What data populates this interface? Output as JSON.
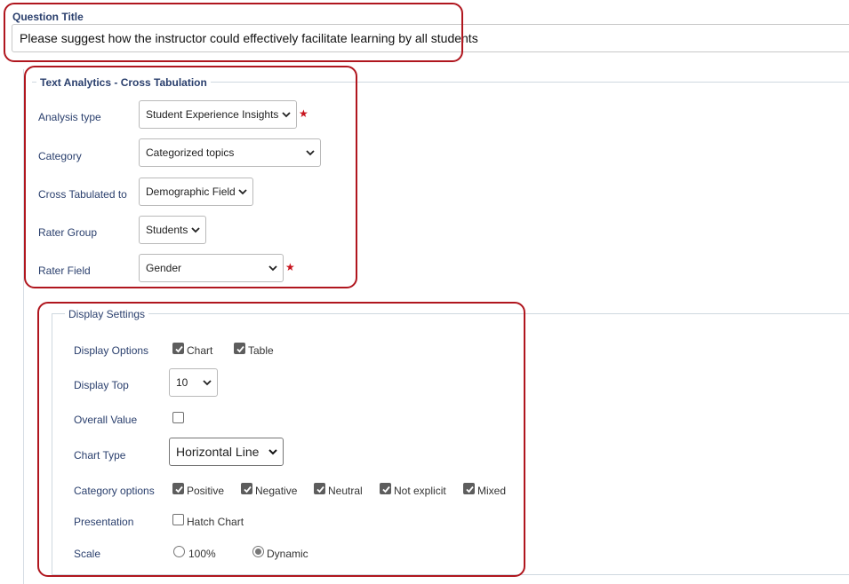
{
  "question": {
    "title_label": "Question Title",
    "title_value": "Please suggest how the instructor could effectively facilitate learning by all students"
  },
  "analytics": {
    "legend": "Text Analytics - Cross Tabulation",
    "analysis_type": {
      "label": "Analysis type",
      "value": "Student Experience Insights",
      "required": true
    },
    "category": {
      "label": "Category",
      "value": "Categorized topics"
    },
    "cross_tab": {
      "label": "Cross Tabulated to",
      "value": "Demographic Field"
    },
    "rater_group": {
      "label": "Rater Group",
      "value": "Students"
    },
    "rater_field": {
      "label": "Rater Field",
      "value": "Gender",
      "required": true
    },
    "required_mark": "★"
  },
  "display": {
    "legend": "Display Settings",
    "display_options": {
      "label": "Display Options",
      "chart": "Chart",
      "table": "Table",
      "chart_checked": true,
      "table_checked": true
    },
    "display_top": {
      "label": "Display Top",
      "value": "10"
    },
    "overall_value": {
      "label": "Overall Value",
      "checked": false
    },
    "chart_type": {
      "label": "Chart Type",
      "value": "Horizontal Line"
    },
    "category_options": {
      "label": "Category options",
      "items": [
        {
          "label": "Positive",
          "checked": true
        },
        {
          "label": "Negative",
          "checked": true
        },
        {
          "label": "Neutral",
          "checked": true
        },
        {
          "label": "Not explicit",
          "checked": true
        },
        {
          "label": "Mixed",
          "checked": true
        }
      ]
    },
    "presentation": {
      "label": "Presentation",
      "hatch": "Hatch Chart",
      "checked": false
    },
    "scale": {
      "label": "Scale",
      "opt_100": "100%",
      "opt_dynamic": "Dynamic",
      "selected": "Dynamic"
    }
  },
  "colors": {
    "highlight": "#b0161e",
    "label": "#2a3f6d",
    "required": "#c8141e"
  }
}
